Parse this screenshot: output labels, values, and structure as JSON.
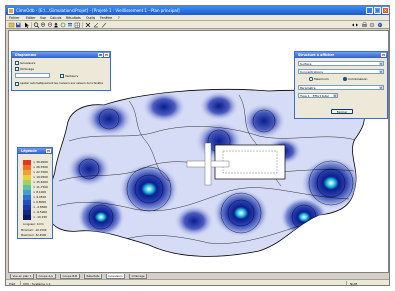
{
  "window": {
    "title": "CimeOdb - [E:\\...\\Simulations\\Projet] - [Projeté 1 : Vieillissement 1 - Plan principal]",
    "minimize_glyph": "_",
    "maximize_glyph": "□",
    "close_glyph": "×"
  },
  "menu": {
    "items": [
      "Fichier",
      "Editer",
      "Vue",
      "Calculs",
      "Résultats",
      "Outils",
      "Fenêtre",
      "?"
    ]
  },
  "toolbar": {
    "icons": [
      "folder-open-icon",
      "save-icon",
      "arrow-icon",
      "magnifier-icon",
      "zoom-in-icon",
      "zoom-out-icon",
      "pan-icon",
      "refresh-icon",
      "layers-icon",
      "grid-icon",
      "cross-icon",
      "measure-icon",
      "pencil-icon"
    ],
    "right_icons": [
      "arrows-icon",
      "print-icon",
      "settings-icon",
      "help-icon"
    ]
  },
  "diagram_panel": {
    "title": "Diagramme",
    "min_glyph": "_",
    "close_glyph": "×",
    "checkbox1_label": "Isovaleurs",
    "checkbox2_label": "Ombrage",
    "checkbox3_label": "Vecteurs",
    "bottom_label": "Ajuster automatiquement les couleurs aux valeurs de la fenêtre"
  },
  "legend_panel": {
    "title": "Légende",
    "close_glyph": "×",
    "values": [
      "> 30.0000",
      "> 26.3500",
      "> 22.7000",
      "> 19.0500",
      "> 15.4000",
      "> 11.7500",
      "> 8.1000",
      "> 4.4500",
      "> 0.8000",
      "> -2.8500",
      "> -6.5000",
      "> -10.150"
    ],
    "colors": [
      "#ee3020",
      "#f07020",
      "#f0a030",
      "#e8d040",
      "#a0d060",
      "#60c0a0",
      "#40a0d0",
      "#3070d0",
      "#2050c0",
      "#1838a8",
      "#102880",
      "#081860"
    ],
    "unit_label": "Longueur: 1mm",
    "min_label": "Minimum: -10.1500",
    "max_label": "Maximum: 32.4500"
  },
  "structure_panel": {
    "title": "Structure à afficher",
    "close_glyph": "×",
    "select1": "Surface",
    "select2": "Concentrations",
    "radio1_label": "Maximum",
    "radio2_label": "Combinaison",
    "select3": "Paramètre",
    "select4": "Type 1 : Effort total",
    "ok_label": "Fermer"
  },
  "tabs": [
    {
      "label": "Vue en plan 1",
      "active": false
    },
    {
      "label": "Coupe A-A",
      "active": false
    },
    {
      "label": "Coupe B-B",
      "active": false
    },
    {
      "label": "Résultats",
      "active": false
    },
    {
      "label": "Isovaleurs",
      "active": true
    },
    {
      "label": "Ombrage",
      "active": false
    }
  ],
  "status": {
    "left": "Prêt",
    "middle": "CPU : Système 1.1",
    "right": "NUM"
  },
  "colors": {
    "title_blue": "#1a5bd0",
    "panel_border": "#3a6bd6",
    "contour_dark": "#0a1e8c",
    "shape_light": "#d6dcf5"
  }
}
